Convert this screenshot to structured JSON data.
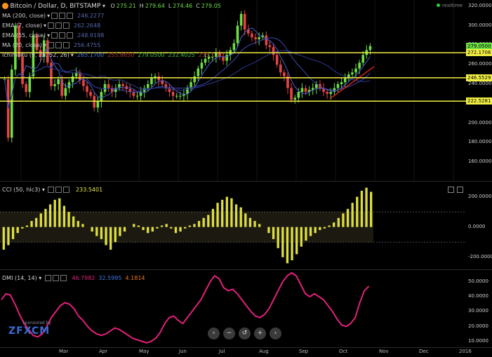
{
  "header": {
    "symbol": "Bitcoin / Dollar, D, BITSTAMP",
    "ohlc": [
      {
        "k": "O",
        "v": "275.21"
      },
      {
        "k": "H",
        "v": "279.64"
      },
      {
        "k": "L",
        "v": "274.46"
      },
      {
        "k": "C",
        "v": "279.05"
      }
    ],
    "realtime": "realtime"
  },
  "indicators": [
    {
      "name": "MA (200, close)",
      "value": "246.2277",
      "color": "#5566aa"
    },
    {
      "name": "EMA (7, close)",
      "value": "262.2648",
      "color": "#5566aa"
    },
    {
      "name": "EMA (55, close)",
      "value": "248.9198",
      "color": "#5566aa"
    },
    {
      "name": "MA (20, close)",
      "value": "256.4755",
      "color": "#5566aa"
    }
  ],
  "ichimoku": {
    "name": "Ichimoku (9, 26, 52, 26)",
    "values": [
      {
        "v": "265.1700",
        "color": "#4477dd"
      },
      {
        "v": "255.8650",
        "color": "#aa3333"
      },
      {
        "v": "279.0500",
        "color": "#44bb44"
      },
      {
        "v": "232.4025",
        "color": "#44bb44"
      },
      {
        "v": "235.1",
        "color": "#aa3333"
      }
    ]
  },
  "price_axis": {
    "ticks": [
      "320.0000",
      "300.0000",
      "280.0000",
      "260.0000",
      "240.0000",
      "220.0000",
      "200.0000",
      "180.0000",
      "160.0000"
    ],
    "tags": [
      {
        "text": "279.0500",
        "bg": "#6dde43",
        "value": 279.05
      },
      {
        "text": "272.1706",
        "bg": "#f2ee44",
        "value": 272.17
      },
      {
        "text": "246.5529",
        "bg": "#f2ee44",
        "value": 246.55
      },
      {
        "text": "222.5281",
        "bg": "#f2ee44",
        "value": 222.53
      }
    ]
  },
  "cci": {
    "name": "CCI (50, hlc3)",
    "value": "233.5401",
    "ticks": [
      "200.0000",
      "0.0000",
      "-200.0000"
    ]
  },
  "dmi": {
    "name": "DMI (14, 14)",
    "values": [
      {
        "v": "46.7982",
        "color": "#e0207a"
      },
      {
        "v": "32.5995",
        "color": "#4477dd"
      },
      {
        "v": "4.1814",
        "color": "#ee7722"
      }
    ],
    "ticks": [
      "50.0000",
      "40.0000",
      "30.0000",
      "20.0000",
      "10.0000"
    ]
  },
  "x_axis": [
    "Mar",
    "Apr",
    "May",
    "Jun",
    "Jul",
    "Aug",
    "Sep",
    "Oct",
    "Nov",
    "Dec",
    "2016"
  ],
  "watermark": {
    "sponsored": "Sponsored by",
    "brand": "FXCM"
  },
  "toolbar": {
    "buttons": [
      {
        "icon": "chevron-left-icon",
        "glyph": "‹"
      },
      {
        "icon": "zoom-out-icon",
        "glyph": "−"
      },
      {
        "icon": "reset-icon",
        "glyph": "↺"
      },
      {
        "icon": "zoom-in-icon",
        "glyph": "+"
      },
      {
        "icon": "chevron-right-icon",
        "glyph": "›"
      }
    ]
  },
  "chart_data": [
    {
      "type": "candlestick",
      "title": "Bitcoin / Dollar, D, BITSTAMP",
      "ylim": [
        145,
        322
      ],
      "horizontal_lines": [
        272.17,
        246.55,
        222.53
      ],
      "closes": [
        245,
        185,
        255,
        300,
        268,
        240,
        232,
        248,
        290,
        275,
        268,
        285,
        262,
        238,
        240,
        245,
        228,
        236,
        242,
        248,
        252,
        244,
        238,
        232,
        228,
        216,
        222,
        232,
        240,
        236,
        232,
        236,
        240,
        238,
        235,
        232,
        228,
        228,
        232,
        236,
        240,
        246,
        248,
        244,
        240,
        236,
        232,
        228,
        228,
        228,
        230,
        236,
        242,
        248,
        256,
        262,
        266,
        268,
        268,
        272,
        268,
        264,
        270,
        275,
        282,
        300,
        312,
        296,
        292,
        288,
        286,
        288,
        290,
        280,
        278,
        270,
        260,
        252,
        248,
        236,
        224,
        226,
        232,
        236,
        232,
        234,
        236,
        240,
        236,
        232,
        230,
        232,
        236,
        240,
        242,
        246,
        250,
        252,
        256,
        262,
        270,
        275,
        279
      ]
    },
    {
      "type": "bar",
      "title": "CCI (50, hlc3)",
      "ylim": [
        -280,
        300
      ],
      "values": [
        -150,
        -120,
        -80,
        -40,
        -10,
        10,
        40,
        60,
        90,
        120,
        150,
        180,
        190,
        140,
        100,
        70,
        40,
        20,
        0,
        -30,
        -60,
        -80,
        -120,
        -150,
        -100,
        -60,
        -30,
        0,
        20,
        10,
        -20,
        -40,
        -30,
        -10,
        10,
        20,
        -10,
        -40,
        -30,
        -10,
        10,
        20,
        40,
        60,
        80,
        120,
        160,
        180,
        200,
        190,
        150,
        130,
        90,
        60,
        40,
        20,
        0,
        -40,
        -80,
        -140,
        -200,
        -240,
        -220,
        -180,
        -130,
        -90,
        -60,
        -40,
        -20,
        -10,
        10,
        30,
        60,
        90,
        120,
        160,
        200,
        240,
        260,
        233
      ]
    },
    {
      "type": "line",
      "title": "DMI (14, 14)",
      "ylim": [
        8,
        56
      ],
      "series": [
        {
          "name": "",
          "values": [
            38,
            42,
            41,
            35,
            28,
            22,
            18,
            14,
            13,
            15,
            20,
            26,
            30,
            34,
            36,
            35,
            32,
            27,
            24,
            20,
            17,
            15,
            14,
            15,
            17,
            19,
            18,
            16,
            14,
            12,
            11,
            10,
            9,
            10,
            12,
            16,
            22,
            26,
            27,
            24,
            22,
            26,
            30,
            34,
            38,
            44,
            50,
            54,
            52,
            46,
            44,
            45,
            42,
            38,
            34,
            30,
            27,
            26,
            28,
            32,
            38,
            44,
            50,
            54,
            56,
            54,
            48,
            42,
            40,
            42,
            40,
            38,
            34,
            30,
            25,
            21,
            20,
            22,
            26,
            36,
            44,
            47
          ]
        }
      ]
    }
  ]
}
